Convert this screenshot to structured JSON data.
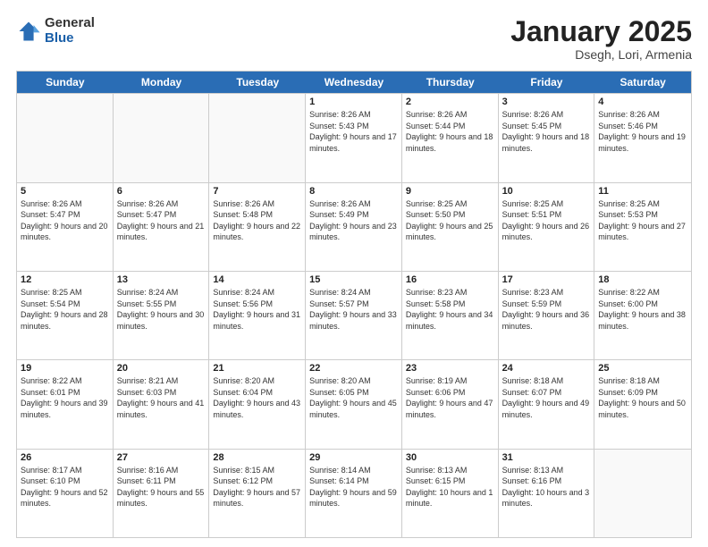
{
  "logo": {
    "general": "General",
    "blue": "Blue"
  },
  "title": {
    "month": "January 2025",
    "location": "Dsegh, Lori, Armenia"
  },
  "header": {
    "days": [
      "Sunday",
      "Monday",
      "Tuesday",
      "Wednesday",
      "Thursday",
      "Friday",
      "Saturday"
    ]
  },
  "weeks": [
    [
      {
        "day": "",
        "sunrise": "",
        "sunset": "",
        "daylight": "",
        "empty": true
      },
      {
        "day": "",
        "sunrise": "",
        "sunset": "",
        "daylight": "",
        "empty": true
      },
      {
        "day": "",
        "sunrise": "",
        "sunset": "",
        "daylight": "",
        "empty": true
      },
      {
        "day": "1",
        "sunrise": "Sunrise: 8:26 AM",
        "sunset": "Sunset: 5:43 PM",
        "daylight": "Daylight: 9 hours and 17 minutes."
      },
      {
        "day": "2",
        "sunrise": "Sunrise: 8:26 AM",
        "sunset": "Sunset: 5:44 PM",
        "daylight": "Daylight: 9 hours and 18 minutes."
      },
      {
        "day": "3",
        "sunrise": "Sunrise: 8:26 AM",
        "sunset": "Sunset: 5:45 PM",
        "daylight": "Daylight: 9 hours and 18 minutes."
      },
      {
        "day": "4",
        "sunrise": "Sunrise: 8:26 AM",
        "sunset": "Sunset: 5:46 PM",
        "daylight": "Daylight: 9 hours and 19 minutes."
      }
    ],
    [
      {
        "day": "5",
        "sunrise": "Sunrise: 8:26 AM",
        "sunset": "Sunset: 5:47 PM",
        "daylight": "Daylight: 9 hours and 20 minutes."
      },
      {
        "day": "6",
        "sunrise": "Sunrise: 8:26 AM",
        "sunset": "Sunset: 5:47 PM",
        "daylight": "Daylight: 9 hours and 21 minutes."
      },
      {
        "day": "7",
        "sunrise": "Sunrise: 8:26 AM",
        "sunset": "Sunset: 5:48 PM",
        "daylight": "Daylight: 9 hours and 22 minutes."
      },
      {
        "day": "8",
        "sunrise": "Sunrise: 8:26 AM",
        "sunset": "Sunset: 5:49 PM",
        "daylight": "Daylight: 9 hours and 23 minutes."
      },
      {
        "day": "9",
        "sunrise": "Sunrise: 8:25 AM",
        "sunset": "Sunset: 5:50 PM",
        "daylight": "Daylight: 9 hours and 25 minutes."
      },
      {
        "day": "10",
        "sunrise": "Sunrise: 8:25 AM",
        "sunset": "Sunset: 5:51 PM",
        "daylight": "Daylight: 9 hours and 26 minutes."
      },
      {
        "day": "11",
        "sunrise": "Sunrise: 8:25 AM",
        "sunset": "Sunset: 5:53 PM",
        "daylight": "Daylight: 9 hours and 27 minutes."
      }
    ],
    [
      {
        "day": "12",
        "sunrise": "Sunrise: 8:25 AM",
        "sunset": "Sunset: 5:54 PM",
        "daylight": "Daylight: 9 hours and 28 minutes."
      },
      {
        "day": "13",
        "sunrise": "Sunrise: 8:24 AM",
        "sunset": "Sunset: 5:55 PM",
        "daylight": "Daylight: 9 hours and 30 minutes."
      },
      {
        "day": "14",
        "sunrise": "Sunrise: 8:24 AM",
        "sunset": "Sunset: 5:56 PM",
        "daylight": "Daylight: 9 hours and 31 minutes."
      },
      {
        "day": "15",
        "sunrise": "Sunrise: 8:24 AM",
        "sunset": "Sunset: 5:57 PM",
        "daylight": "Daylight: 9 hours and 33 minutes."
      },
      {
        "day": "16",
        "sunrise": "Sunrise: 8:23 AM",
        "sunset": "Sunset: 5:58 PM",
        "daylight": "Daylight: 9 hours and 34 minutes."
      },
      {
        "day": "17",
        "sunrise": "Sunrise: 8:23 AM",
        "sunset": "Sunset: 5:59 PM",
        "daylight": "Daylight: 9 hours and 36 minutes."
      },
      {
        "day": "18",
        "sunrise": "Sunrise: 8:22 AM",
        "sunset": "Sunset: 6:00 PM",
        "daylight": "Daylight: 9 hours and 38 minutes."
      }
    ],
    [
      {
        "day": "19",
        "sunrise": "Sunrise: 8:22 AM",
        "sunset": "Sunset: 6:01 PM",
        "daylight": "Daylight: 9 hours and 39 minutes."
      },
      {
        "day": "20",
        "sunrise": "Sunrise: 8:21 AM",
        "sunset": "Sunset: 6:03 PM",
        "daylight": "Daylight: 9 hours and 41 minutes."
      },
      {
        "day": "21",
        "sunrise": "Sunrise: 8:20 AM",
        "sunset": "Sunset: 6:04 PM",
        "daylight": "Daylight: 9 hours and 43 minutes."
      },
      {
        "day": "22",
        "sunrise": "Sunrise: 8:20 AM",
        "sunset": "Sunset: 6:05 PM",
        "daylight": "Daylight: 9 hours and 45 minutes."
      },
      {
        "day": "23",
        "sunrise": "Sunrise: 8:19 AM",
        "sunset": "Sunset: 6:06 PM",
        "daylight": "Daylight: 9 hours and 47 minutes."
      },
      {
        "day": "24",
        "sunrise": "Sunrise: 8:18 AM",
        "sunset": "Sunset: 6:07 PM",
        "daylight": "Daylight: 9 hours and 49 minutes."
      },
      {
        "day": "25",
        "sunrise": "Sunrise: 8:18 AM",
        "sunset": "Sunset: 6:09 PM",
        "daylight": "Daylight: 9 hours and 50 minutes."
      }
    ],
    [
      {
        "day": "26",
        "sunrise": "Sunrise: 8:17 AM",
        "sunset": "Sunset: 6:10 PM",
        "daylight": "Daylight: 9 hours and 52 minutes."
      },
      {
        "day": "27",
        "sunrise": "Sunrise: 8:16 AM",
        "sunset": "Sunset: 6:11 PM",
        "daylight": "Daylight: 9 hours and 55 minutes."
      },
      {
        "day": "28",
        "sunrise": "Sunrise: 8:15 AM",
        "sunset": "Sunset: 6:12 PM",
        "daylight": "Daylight: 9 hours and 57 minutes."
      },
      {
        "day": "29",
        "sunrise": "Sunrise: 8:14 AM",
        "sunset": "Sunset: 6:14 PM",
        "daylight": "Daylight: 9 hours and 59 minutes."
      },
      {
        "day": "30",
        "sunrise": "Sunrise: 8:13 AM",
        "sunset": "Sunset: 6:15 PM",
        "daylight": "Daylight: 10 hours and 1 minute."
      },
      {
        "day": "31",
        "sunrise": "Sunrise: 8:13 AM",
        "sunset": "Sunset: 6:16 PM",
        "daylight": "Daylight: 10 hours and 3 minutes."
      },
      {
        "day": "",
        "sunrise": "",
        "sunset": "",
        "daylight": "",
        "empty": true
      }
    ]
  ]
}
